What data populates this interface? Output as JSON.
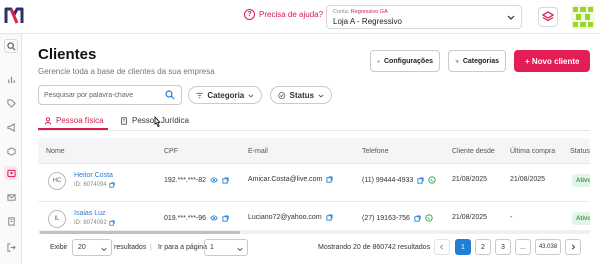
{
  "topbar": {
    "help_label": "Precisa de ajuda?",
    "store_caption": "Conta:",
    "store_group": "Regressivo GA",
    "store_name": "Loja A - Regressivo"
  },
  "sidebar": {
    "items": [
      "home-icon",
      "chart-icon",
      "tag-icon",
      "megaphone-icon",
      "box-icon",
      "clients-icon",
      "mail-icon",
      "building-icon",
      "settings-icon",
      "logout-icon"
    ],
    "active": "clients-icon"
  },
  "page": {
    "title": "Clientes",
    "subtitle": "Gerencie toda a base de clientes da sua empresa"
  },
  "actions": {
    "config_label": "Configurações",
    "categories_label": "Categorias",
    "new_client_label": "+ Novo cliente"
  },
  "filters": {
    "search_placeholder": "Pesquisar por palavra-chave",
    "category_label": "Categoria",
    "status_label": "Status"
  },
  "tabs": [
    {
      "label": "Pessoa física",
      "active": true
    },
    {
      "label": "Pessoa Jurídica",
      "active": false
    }
  ],
  "table": {
    "columns": [
      "Nome",
      "CPF",
      "E-mail",
      "Telefone",
      "Cliente desde",
      "Última compra",
      "Status"
    ],
    "rows": [
      {
        "initials": "HC",
        "name": "Heitor Costa",
        "id": "ID: 6074094",
        "cpf": "192.***.***-82",
        "email": "Amicar.Costa@live.com",
        "phone": "(11) 99444-4933",
        "since": "21/08/2025",
        "last_purchase": "21/08/2025",
        "status": "Ativo"
      },
      {
        "initials": "IL",
        "name": "Isaias Luz",
        "id": "ID: 6074092",
        "cpf": "019.***.***-96",
        "email": "Luciano72@yahoo.com",
        "phone": "(27) 19163-756",
        "since": "21/08/2025",
        "last_purchase": "-",
        "status": "Ativo"
      }
    ]
  },
  "footer": {
    "show_label": "Exibir",
    "per_page": "20",
    "results_label": "resultados",
    "goto_label": "Ir para a página",
    "page_value": "1",
    "summary": "Mostrando 20 de 860742 resultados",
    "pages": [
      "1",
      "2",
      "3",
      "...",
      "43.038"
    ],
    "current_page": "1"
  },
  "colors": {
    "accent": "#e21e55",
    "link": "#2a7bd8",
    "active_page": "#1e7fd6",
    "status_active": "#3a9b45"
  }
}
